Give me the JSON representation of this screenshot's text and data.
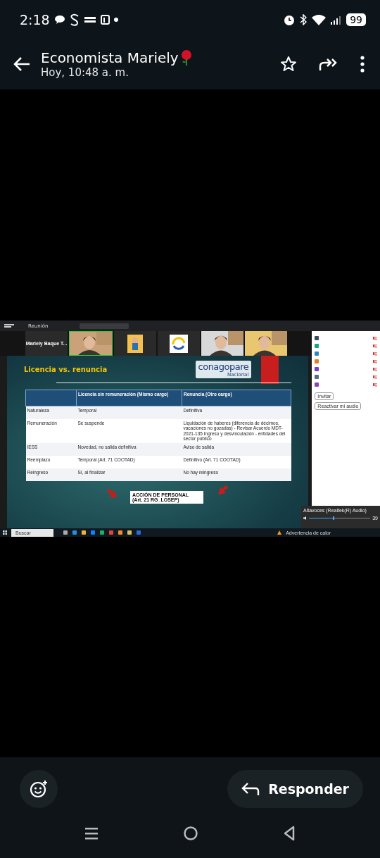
{
  "status_bar": {
    "time": "2:18",
    "battery": "99"
  },
  "header": {
    "title": "Economista Mariely",
    "subtitle": "Hoy, 10:48 a. m."
  },
  "shared_image": {
    "meeting_bar": {
      "app": "Reunión"
    },
    "tiles": [
      {
        "kind": "name",
        "name": "Mariely Baque T..."
      },
      {
        "kind": "video",
        "color": "#c9a27a"
      },
      {
        "kind": "avatar",
        "color": "#f2c14e"
      },
      {
        "kind": "logo",
        "color": "#ffffff"
      },
      {
        "kind": "video",
        "color": "#d8d8d8"
      },
      {
        "kind": "video",
        "color": "#e8c770"
      }
    ],
    "slide": {
      "title": "Licencia vs. renuncia",
      "logo_text": "conagopare",
      "logo_sub": "Nacional",
      "columns": [
        "Licencia sin remuneración (Mismo cargo)",
        "Renuncia (Otro cargo)"
      ],
      "rows": [
        {
          "label": "Naturaleza",
          "licencia": "Temporal",
          "renuncia": "Definitiva"
        },
        {
          "label": "Remuneración",
          "licencia": "Se suspende",
          "renuncia": "Liquidación de haberes (diferencia de décimos, vacaciones no gozadas) - Revisar Acuerdo MDT-2021-135 Ingreso y desvinculación - entidades del sector público"
        },
        {
          "label": "IESS",
          "licencia": "Novedad, no salida definitiva",
          "renuncia": "Aviso de salida"
        },
        {
          "label": "Reemplazo",
          "licencia": "Temporal (Art. 71 COOTAD)",
          "renuncia": "Definitivo (Art. 71 COOTAD)"
        },
        {
          "label": "Reingreso",
          "licencia": "Sí, al finalizar",
          "renuncia": "No hay reingreso"
        }
      ],
      "callout": [
        "ACCIÓN DE PERSONAL",
        "(Art. 21 RG_LOSEP)"
      ]
    },
    "participants": {
      "items": [
        {
          "color": "#3d4a5c"
        },
        {
          "color": "#17a589"
        },
        {
          "color": "#2e86c1"
        },
        {
          "color": "#e67e22"
        },
        {
          "color": "#7d3cc8"
        },
        {
          "color": "#5d6d7e"
        },
        {
          "color": "#8e44ad"
        }
      ],
      "buttons": [
        "Invitar",
        "Reactivar mi audio"
      ]
    },
    "audio": {
      "device": "Altavoces (Realtek(R) Audio)",
      "level": 0.39,
      "reading": "39"
    },
    "taskbar": {
      "search": "Buscar",
      "alert": "Advertencia de calor"
    }
  },
  "reply": {
    "label": "Responder"
  }
}
